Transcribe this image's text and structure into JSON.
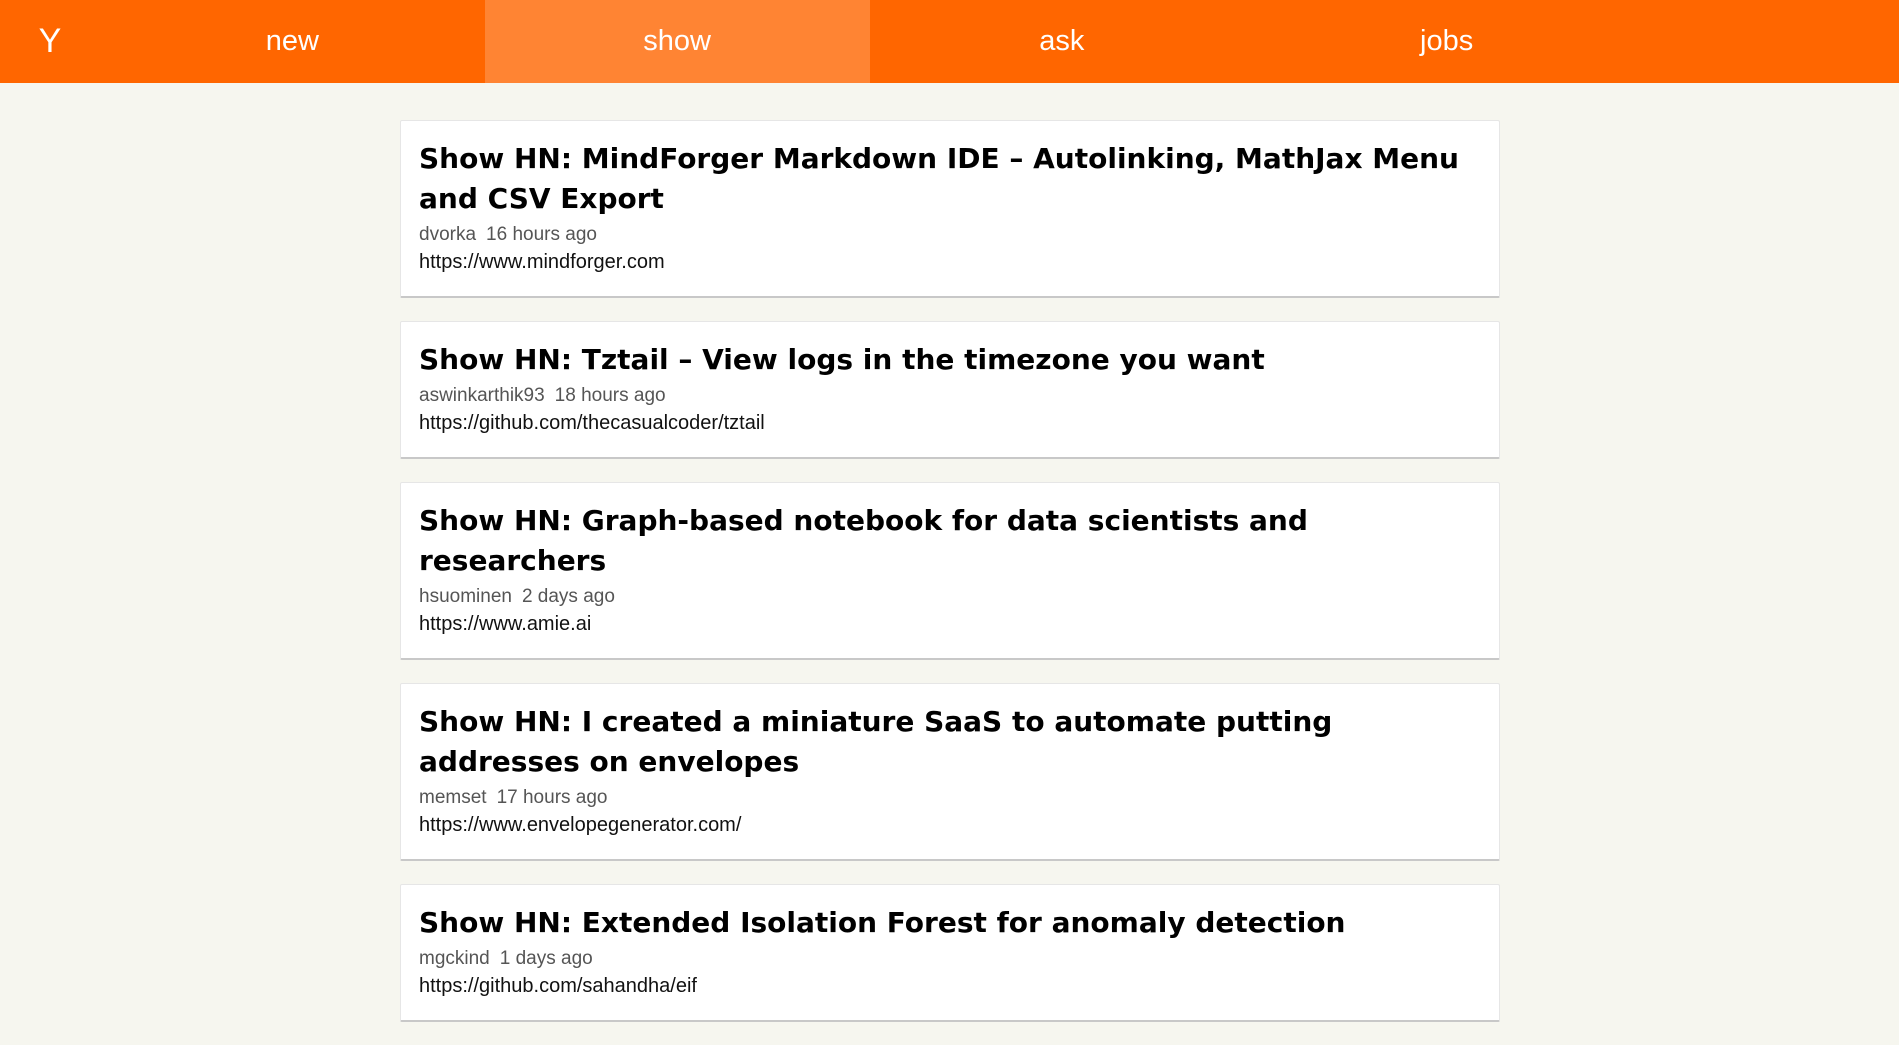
{
  "header": {
    "logo": "Y",
    "nav": [
      {
        "label": "new",
        "active": false
      },
      {
        "label": "show",
        "active": true
      },
      {
        "label": "ask",
        "active": false
      },
      {
        "label": "jobs",
        "active": false
      }
    ]
  },
  "stories": [
    {
      "title": "Show HN: MindForger Markdown IDE – Autolinking, MathJax Menu and CSV Export",
      "author": "dvorka",
      "time": "16 hours ago",
      "url": "https://www.mindforger.com"
    },
    {
      "title": "Show HN: Tztail – View logs in the timezone you want",
      "author": "aswinkarthik93",
      "time": "18 hours ago",
      "url": "https://github.com/thecasualcoder/tztail"
    },
    {
      "title": "Show HN: Graph-based notebook for data scientists and researchers",
      "author": "hsuominen",
      "time": "2 days ago",
      "url": "https://www.amie.ai"
    },
    {
      "title": "Show HN: I created a miniature SaaS to automate putting addresses on envelopes",
      "author": "memset",
      "time": "17 hours ago",
      "url": "https://www.envelopegenerator.com/"
    },
    {
      "title": "Show HN: Extended Isolation Forest for anomaly detection",
      "author": "mgckind",
      "time": "1 days ago",
      "url": "https://github.com/sahandha/eif"
    }
  ],
  "colors": {
    "brand": "#ff6600",
    "active_tab": "#ff8433",
    "background": "#f6f6ef"
  }
}
